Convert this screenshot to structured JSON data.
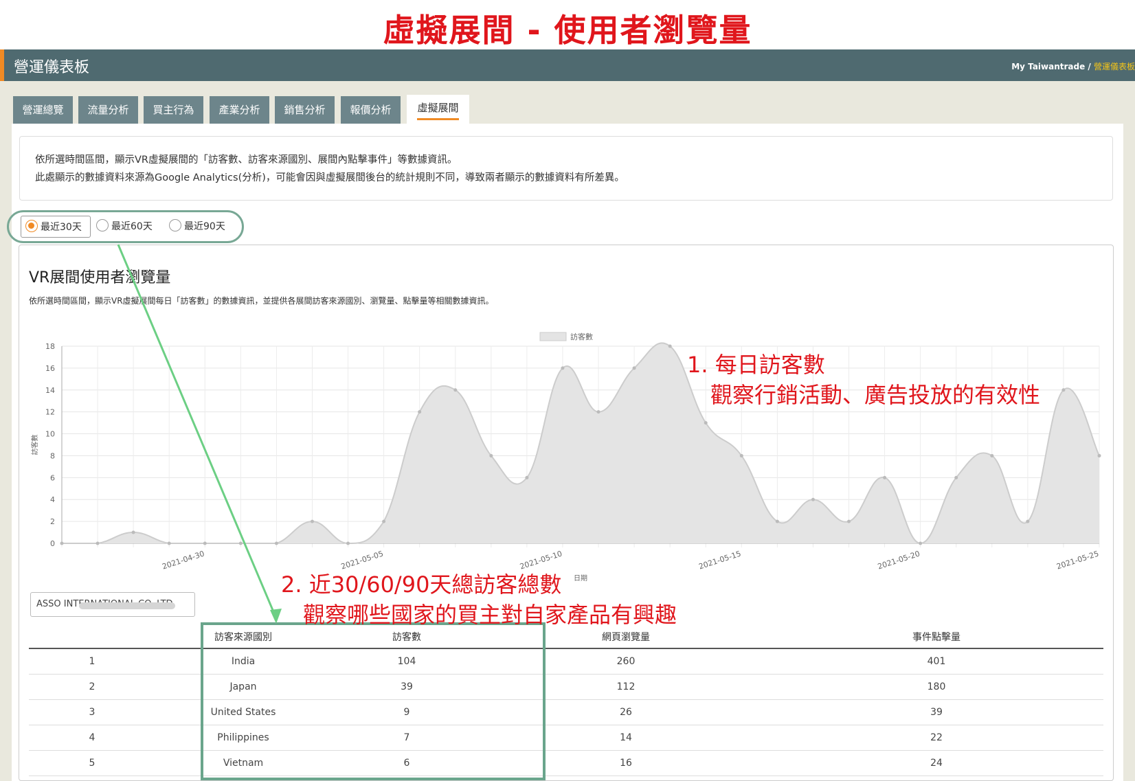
{
  "headline": "虛擬展間 - 使用者瀏覽量",
  "topbar": {
    "title": "營運儀表板",
    "crumb_home": "My Taiwantrade",
    "crumb_sep": " / ",
    "crumb_current": "營運儀表板"
  },
  "tabs": [
    {
      "label": "營運總覽",
      "active": false
    },
    {
      "label": "流量分析",
      "active": false
    },
    {
      "label": "買主行為",
      "active": false
    },
    {
      "label": "產業分析",
      "active": false
    },
    {
      "label": "銷售分析",
      "active": false
    },
    {
      "label": "報價分析",
      "active": false
    },
    {
      "label": "虛擬展間",
      "active": true
    }
  ],
  "notice": {
    "line1": "依所選時間區間，顯示VR虛擬展間的「訪客數、訪客來源國別、展間內點擊事件」等數據資訊。",
    "line2": "此處顯示的數據資料來源為Google Analytics(分析)，可能會因與虛擬展間後台的統計規則不同，導致兩者顯示的數據資料有所差異。"
  },
  "range": {
    "options": [
      "最近30天",
      "最近60天",
      "最近90天"
    ],
    "selected": "最近30天"
  },
  "chart": {
    "title": "VR展間使用者瀏覽量",
    "desc": "依所選時間區間，顯示VR虛擬展間每日「訪客數」的數據資訊，並提供各展間訪客來源國別、瀏覽量、點擊量等相關數據資訊。"
  },
  "chart_data": {
    "type": "area",
    "legend": "訪客數",
    "legend_position": "top-center",
    "xlabel": "日期",
    "ylabel": "訪客數",
    "ylim": [
      0,
      18
    ],
    "yticks": [
      0,
      2,
      4,
      6,
      8,
      10,
      12,
      14,
      16,
      18
    ],
    "grid": true,
    "x": [
      "2021-04-26",
      "2021-04-27",
      "2021-04-28",
      "2021-04-29",
      "2021-04-30",
      "2021-05-01",
      "2021-05-02",
      "2021-05-03",
      "2021-05-04",
      "2021-05-05",
      "2021-05-06",
      "2021-05-07",
      "2021-05-08",
      "2021-05-09",
      "2021-05-10",
      "2021-05-11",
      "2021-05-12",
      "2021-05-13",
      "2021-05-14",
      "2021-05-15",
      "2021-05-16",
      "2021-05-17",
      "2021-05-18",
      "2021-05-19",
      "2021-05-20",
      "2021-05-21",
      "2021-05-22",
      "2021-05-23",
      "2021-05-24",
      "2021-05-25"
    ],
    "x_tick_labels": [
      "2021-04-30",
      "2021-05-05",
      "2021-05-10",
      "2021-05-15",
      "2021-05-20",
      "2021-05-25"
    ],
    "values": [
      0,
      0,
      1,
      0,
      0,
      0,
      0,
      2,
      0,
      2,
      12,
      14,
      8,
      6,
      16,
      12,
      16,
      18,
      11,
      8,
      2,
      4,
      2,
      6,
      0,
      6,
      8,
      2,
      14,
      8
    ],
    "colors": {
      "fill": "#e4e4e4",
      "line": "#cccccc",
      "point": "#bbbbbb"
    }
  },
  "company_select": {
    "value": "ASSO INTERNATIONAL CO.,LTD."
  },
  "table": {
    "headers": [
      "",
      "訪客來源國別",
      "訪客數",
      "網頁瀏覽量",
      "事件點擊量"
    ],
    "rows": [
      [
        "1",
        "India",
        "104",
        "260",
        "401"
      ],
      [
        "2",
        "Japan",
        "39",
        "112",
        "180"
      ],
      [
        "3",
        "United States",
        "9",
        "26",
        "39"
      ],
      [
        "4",
        "Philippines",
        "7",
        "14",
        "22"
      ],
      [
        "5",
        "Vietnam",
        "6",
        "16",
        "24"
      ]
    ]
  },
  "annotations": {
    "a1_line1": "1. 每日訪客數",
    "a1_line2": "觀察行銷活動、廣告投放的有效性",
    "a2_line1": "2. 近30/60/90天總訪客總數",
    "a2_line2": "觀察哪些國家的買主對自家產品有興趣"
  },
  "colors": {
    "accent": "#f08a24",
    "topbar": "#4f6a70",
    "tab": "#6d858b",
    "annotation": "#e0161c",
    "highlight": "#6aa58c"
  }
}
